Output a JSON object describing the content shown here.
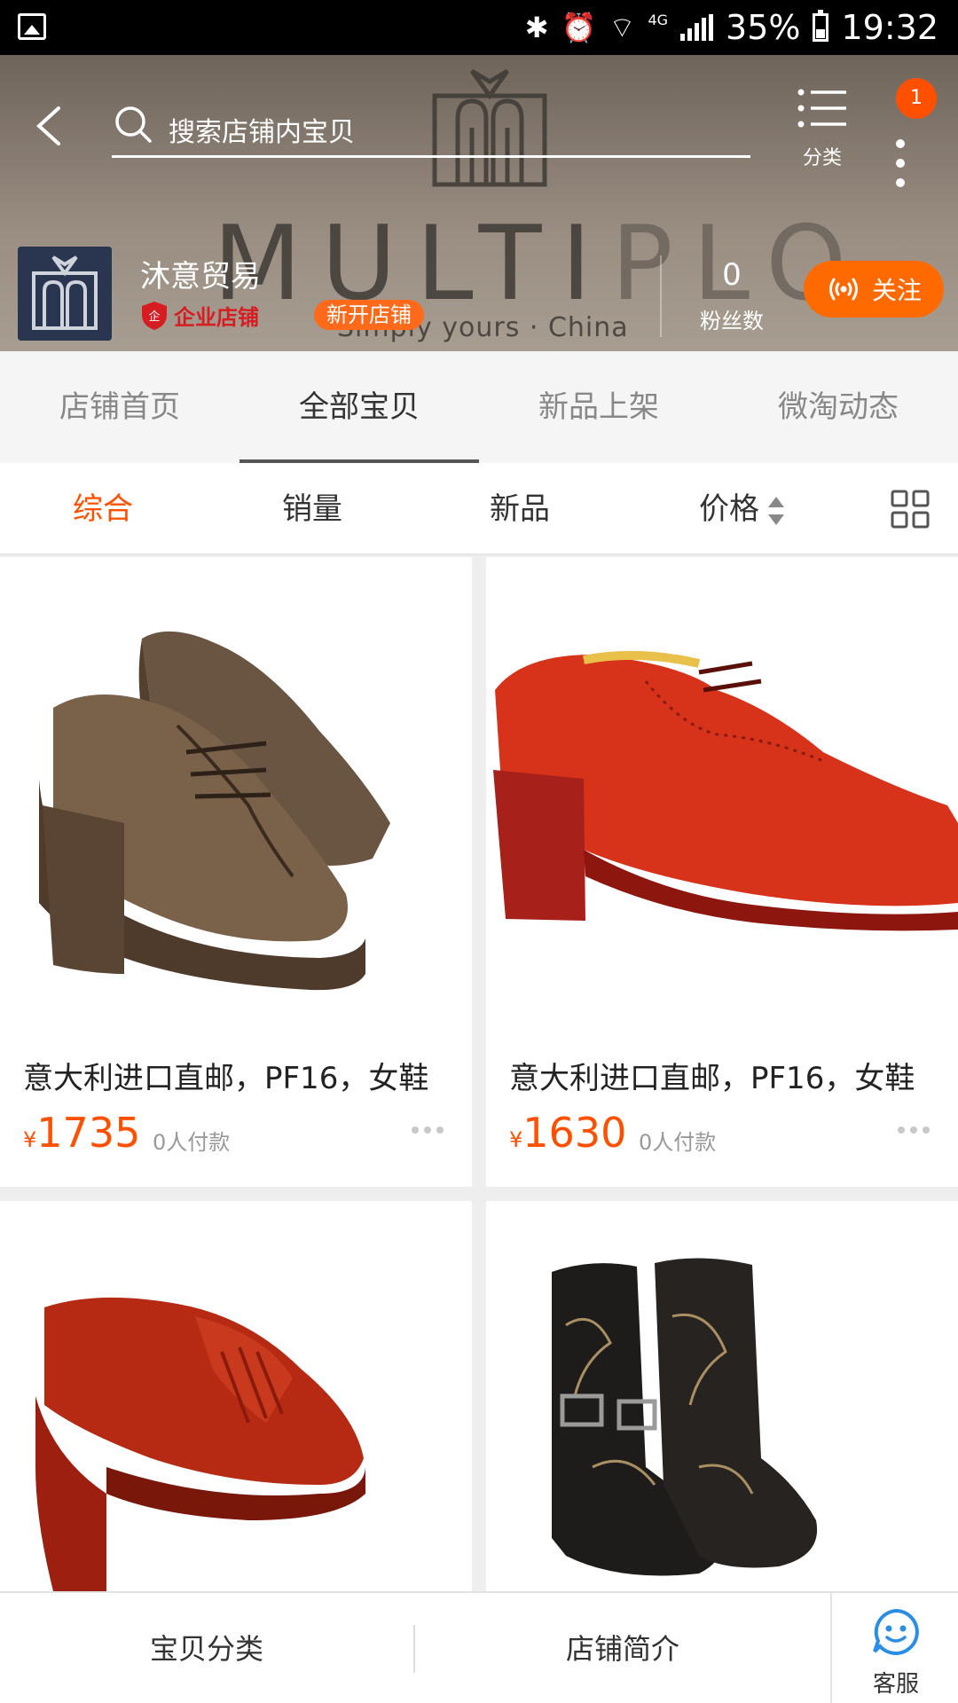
{
  "status_bar": {
    "battery": "35%",
    "time": "19:32",
    "network": "4G"
  },
  "header": {
    "search_placeholder": "搜索店铺内宝贝",
    "category_label": "分类",
    "notification_badge": "1",
    "banner": {
      "brand_word_dark": "MULTI",
      "brand_word_light": "PLO",
      "tagline": "Simply yours · China"
    }
  },
  "store": {
    "name": "沐意贸易",
    "enterprise_badge": "企业店铺",
    "new_store_badge": "新开店铺",
    "fans_count": "0",
    "fans_label": "粉丝数",
    "follow_label": "关注"
  },
  "tabs": [
    {
      "label": "店铺首页",
      "active": false
    },
    {
      "label": "全部宝贝",
      "active": true
    },
    {
      "label": "新品上架",
      "active": false
    },
    {
      "label": "微淘动态",
      "active": false
    }
  ],
  "sort": {
    "overall": "综合",
    "sales": "销量",
    "new": "新品",
    "price": "价格"
  },
  "products": [
    {
      "title": "意大利进口直邮，PF16，女鞋",
      "currency": "¥",
      "price": "1735",
      "sold": "0人付款",
      "image": "brown-brogue-platform-shoe"
    },
    {
      "title": "意大利进口直邮，PF16，女鞋",
      "currency": "¥",
      "price": "1630",
      "sold": "0人付款",
      "image": "red-brogue-heel-shoe"
    },
    {
      "title": "",
      "currency": "",
      "price": "",
      "sold": "",
      "image": "red-patent-fringe-platform-shoe"
    },
    {
      "title": "",
      "currency": "",
      "price": "",
      "sold": "",
      "image": "black-embroidered-ankle-boots"
    }
  ],
  "bottom_bar": {
    "categories": "宝贝分类",
    "intro": "店铺简介",
    "service": "客服"
  },
  "colors": {
    "accent": "#ff5000",
    "follow": "#ff6a00",
    "enterprise": "#d61d22",
    "header_bg": "#8a7f74"
  }
}
